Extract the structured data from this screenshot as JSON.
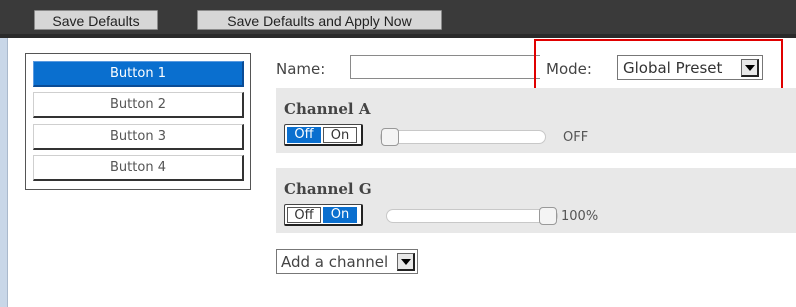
{
  "toolbar": {
    "save_defaults_label": "Save Defaults",
    "save_apply_label": "Save Defaults and Apply Now"
  },
  "buttons": [
    {
      "label": "Button 1",
      "selected": true
    },
    {
      "label": "Button 2",
      "selected": false
    },
    {
      "label": "Button 3",
      "selected": false
    },
    {
      "label": "Button 4",
      "selected": false
    }
  ],
  "form": {
    "name_label": "Name:",
    "name_value": "",
    "mode_label": "Mode:",
    "mode_value": "Global Preset"
  },
  "channels": [
    {
      "title": "Channel A",
      "off_label": "Off",
      "on_label": "On",
      "state": "Off",
      "value_text": "OFF",
      "level": 0
    },
    {
      "title": "Channel G",
      "off_label": "Off",
      "on_label": "On",
      "state": "On",
      "value_text": "100%",
      "level": 1
    }
  ],
  "add_channel": {
    "label": "Add a channel"
  },
  "colors": {
    "accent": "#0a6fcf",
    "highlight": "#e00000"
  }
}
